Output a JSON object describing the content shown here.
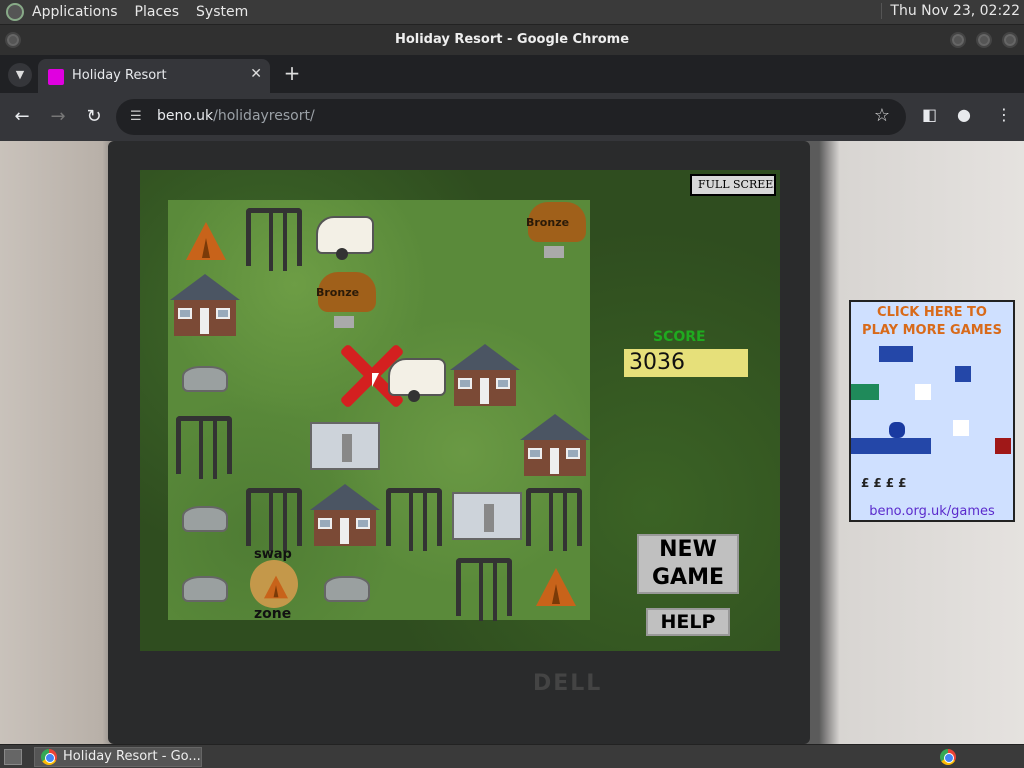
{
  "top_panel": {
    "menus": [
      "Applications",
      "Places",
      "System"
    ],
    "clock": "Thu Nov 23, 02:22"
  },
  "window": {
    "title": "Holiday Resort - Google Chrome"
  },
  "tab": {
    "title": "Holiday Resort",
    "close": "✕",
    "new_tab": "+"
  },
  "toolbar": {
    "url_host": "beno.uk",
    "url_path": "/holidayresort/"
  },
  "game": {
    "fullscreen_label": "FULL SCREEN",
    "score_label": "SCORE",
    "score_value": "3036",
    "new_game_label_1": "NEW",
    "new_game_label_2": "GAME",
    "help_label": "HELP",
    "trophy_label": "Bronze",
    "swap_label": "swap",
    "zone_label": "zone"
  },
  "ad": {
    "title_1": "CLICK HERE TO",
    "title_2": "PLAY MORE GAMES",
    "link": "beno.org.uk/games",
    "coins": "£"
  },
  "taskbar": {
    "task_label": "Holiday Resort - Go..."
  },
  "laptop_logo": "DELL"
}
